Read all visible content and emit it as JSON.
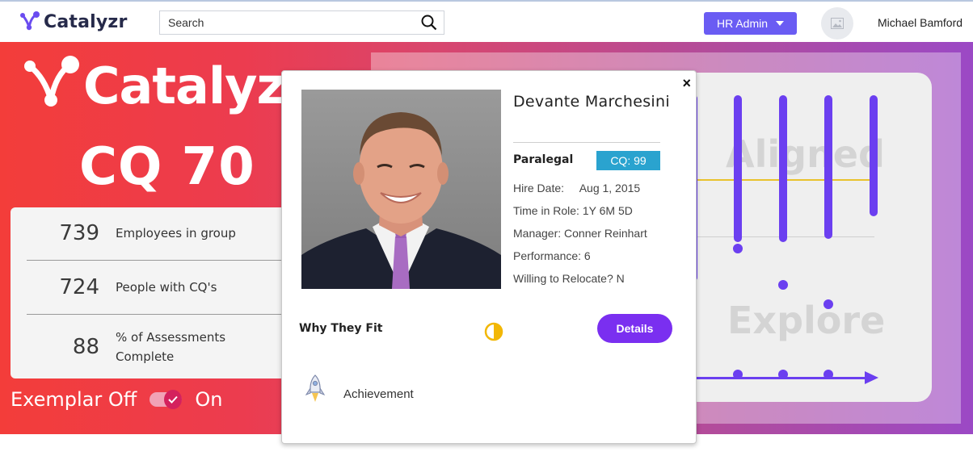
{
  "app": {
    "name": "Catalyzr",
    "search_placeholder": "Search",
    "role_menu_label": "HR Admin",
    "user_name": "Michael Bamford"
  },
  "hero": {
    "brand": "Catalyzr",
    "cq_score": "CQ 70",
    "stats": [
      {
        "value": "739",
        "label": "Employees in group"
      },
      {
        "value": "724",
        "label": "People with CQ's"
      },
      {
        "value": "88",
        "label": "% of Assessments Complete"
      }
    ],
    "exemplar_off_label": "Exemplar Off",
    "exemplar_on_label": "On",
    "exemplar_enabled": true
  },
  "quadrant": {
    "labels": [
      "Aligned",
      "Explore"
    ]
  },
  "employee_card": {
    "name": "Devante Marchesini",
    "title": "Paralegal",
    "cq_badge": "CQ: 99",
    "details": [
      "Hire Date:     Aug 1, 2015",
      "Time in Role: 1Y 6M 5D",
      "Manager: Conner Reinhart",
      "Performance: 6",
      "Willing to Relocate? N"
    ],
    "why_label": "Why They Fit",
    "details_button": "Details",
    "fit_item": "Achievement",
    "close_symbol": "×"
  },
  "colors": {
    "accent_purple": "#6a5cf3",
    "button_purple": "#7a2ff0",
    "cq_badge": "#2aa3cf",
    "hero_start": "#f33d3a",
    "hero_end": "#9b49c5",
    "chart_purple": "#6b3ff0",
    "yellow_line": "#e9c22d"
  },
  "icons": [
    "catalyzr-logo-icon",
    "search-icon",
    "caret-down-icon",
    "image-placeholder-icon",
    "close-icon",
    "half-circle-icon",
    "rocket-icon",
    "check-icon"
  ]
}
